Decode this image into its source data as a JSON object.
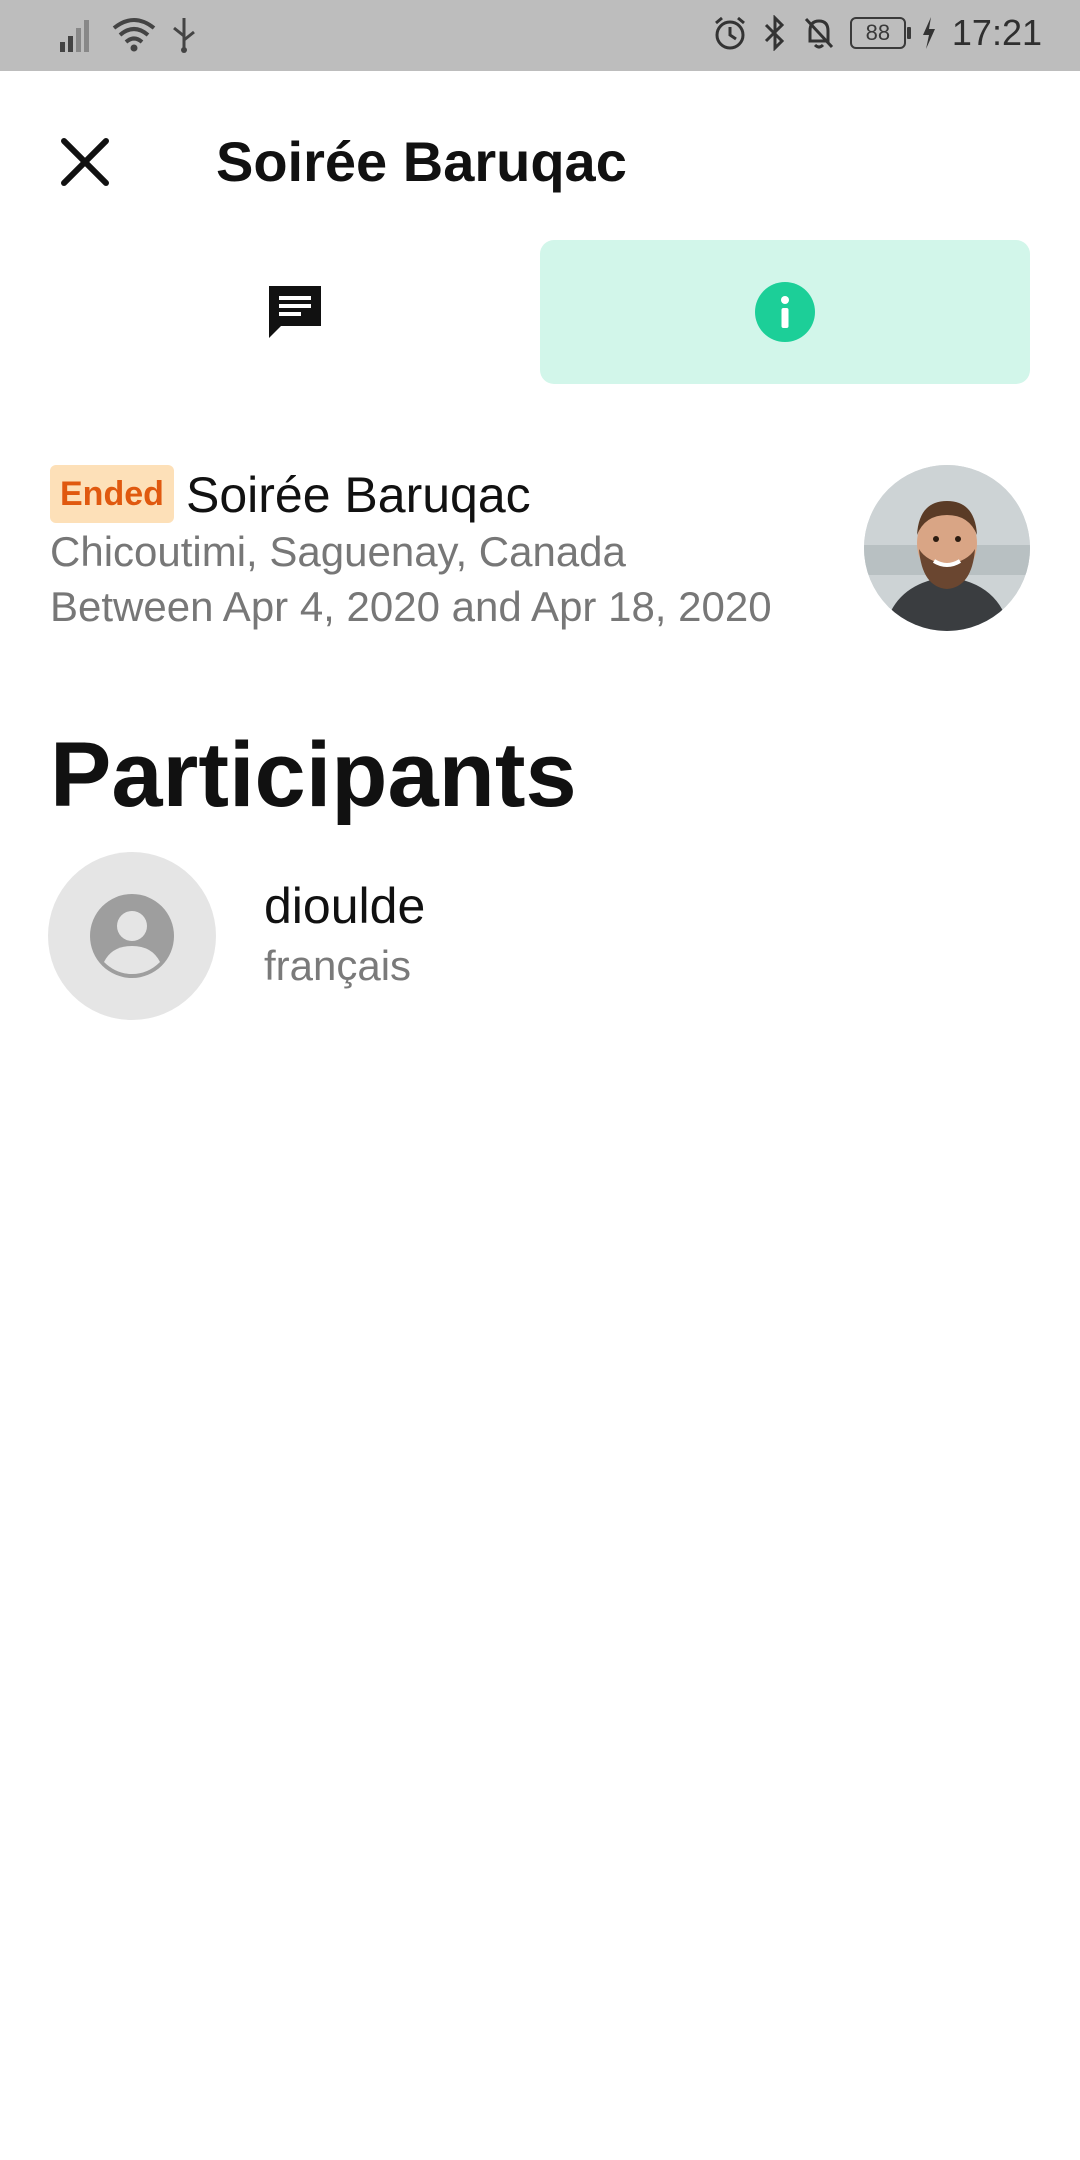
{
  "status_bar": {
    "icons": [
      "signal-icon",
      "wifi-icon",
      "usb-icon",
      "alarm-icon",
      "bluetooth-icon",
      "bell-off-icon",
      "battery-icon",
      "charging-icon"
    ],
    "battery": "88",
    "time": "17:21"
  },
  "header": {
    "close_icon": "close-icon",
    "title": "Soirée Baruqac"
  },
  "tabs": [
    {
      "icon": "chat-icon",
      "selected": false
    },
    {
      "icon": "info-icon",
      "selected": true
    }
  ],
  "event": {
    "status": "Ended",
    "name": "Soirée Baruqac",
    "location": "Chicoutimi, Saguenay, Canada",
    "dates": "Between Apr 4, 2020 and Apr 18, 2020"
  },
  "participants": {
    "title": "Participants",
    "items": [
      {
        "name": "dioulde",
        "language": "français"
      }
    ]
  },
  "colors": {
    "accent": "#1ccf98",
    "tab_selected_bg": "#d2f6ea",
    "badge_bg": "#fde0b8",
    "badge_text": "#e0590f",
    "status_bar_bg": "#bdbdbd"
  }
}
